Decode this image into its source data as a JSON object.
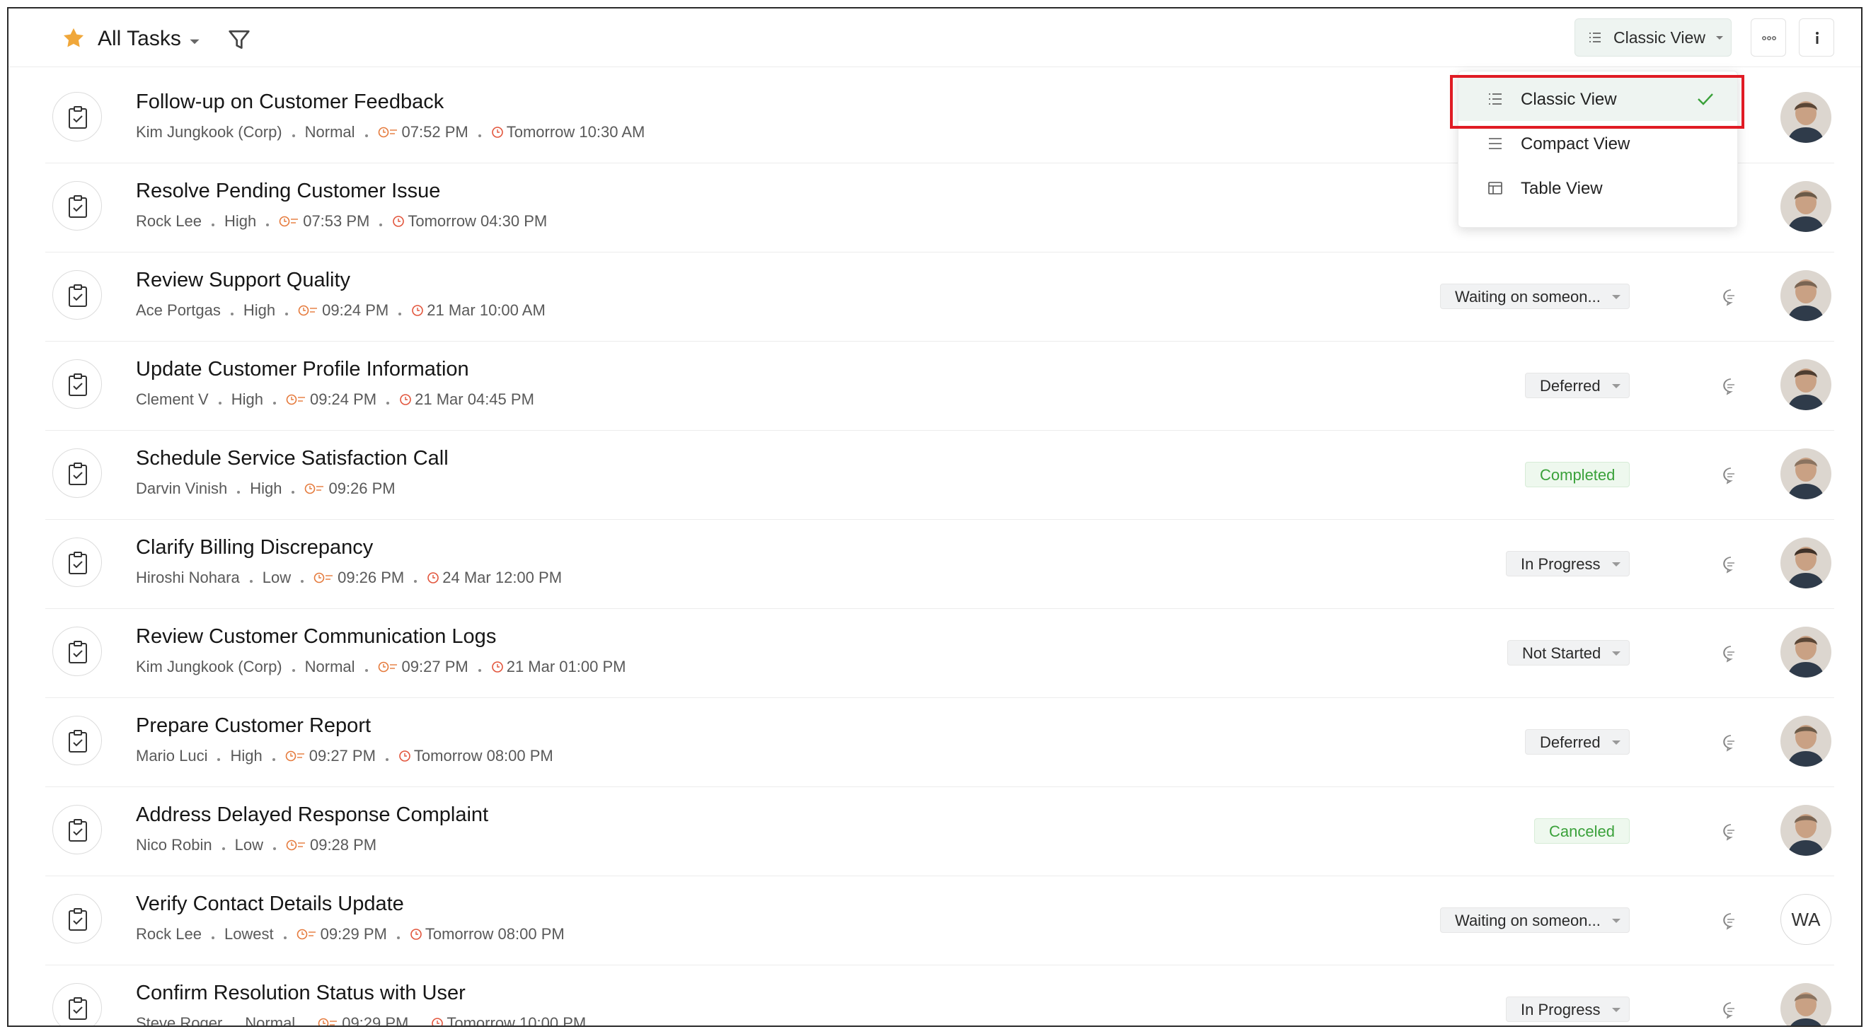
{
  "header": {
    "title": "All Tasks",
    "view_button_label": "Classic View",
    "colors": {
      "star": "#f0a73a",
      "accent_bg": "#eef4f1"
    }
  },
  "view_menu": {
    "items": [
      {
        "label": "Classic View",
        "icon": "list-icon",
        "selected": true
      },
      {
        "label": "Compact View",
        "icon": "compact-list-icon",
        "selected": false
      },
      {
        "label": "Table View",
        "icon": "table-icon",
        "selected": false
      }
    ]
  },
  "tasks": [
    {
      "title": "Follow-up on Customer Feedback",
      "owner": "Kim Jungkook (Corp)",
      "priority": "Normal",
      "created": "07:52 PM",
      "due": "Tomorrow 10:30 AM",
      "status": "",
      "avatar": "photo"
    },
    {
      "title": "Resolve Pending Customer Issue",
      "owner": "Rock Lee",
      "priority": "High",
      "created": "07:53 PM",
      "due": "Tomorrow 04:30 PM",
      "status": "",
      "avatar": "photo"
    },
    {
      "title": "Review Support Quality",
      "owner": "Ace Portgas",
      "priority": "High",
      "created": "09:24 PM",
      "due": "21 Mar 10:00 AM",
      "status": "Waiting on someon...",
      "avatar": "photo"
    },
    {
      "title": "Update Customer Profile Information",
      "owner": "Clement V",
      "priority": "High",
      "created": "09:24 PM",
      "due": "21 Mar 04:45 PM",
      "status": "Deferred",
      "avatar": "photo"
    },
    {
      "title": "Schedule Service Satisfaction Call",
      "owner": "Darvin Vinish",
      "priority": "High",
      "created": "09:26 PM",
      "due": "",
      "status": "Completed",
      "avatar": "photo"
    },
    {
      "title": "Clarify Billing Discrepancy",
      "owner": "Hiroshi Nohara",
      "priority": "Low",
      "created": "09:26 PM",
      "due": "24 Mar 12:00 PM",
      "status": "In Progress",
      "avatar": "photo"
    },
    {
      "title": "Review Customer Communication Logs",
      "owner": "Kim Jungkook (Corp)",
      "priority": "Normal",
      "created": "09:27 PM",
      "due": "21 Mar 01:00 PM",
      "status": "Not Started",
      "avatar": "photo"
    },
    {
      "title": "Prepare Customer Report",
      "owner": "Mario Luci",
      "priority": "High",
      "created": "09:27 PM",
      "due": "Tomorrow 08:00 PM",
      "status": "Deferred",
      "avatar": "photo"
    },
    {
      "title": "Address Delayed Response Complaint",
      "owner": "Nico Robin",
      "priority": "Low",
      "created": "09:28 PM",
      "due": "",
      "status": "Canceled",
      "avatar": "photo"
    },
    {
      "title": "Verify Contact Details Update",
      "owner": "Rock Lee",
      "priority": "Lowest",
      "created": "09:29 PM",
      "due": "Tomorrow 08:00 PM",
      "status": "Waiting on someon...",
      "avatar": "WA"
    },
    {
      "title": "Confirm Resolution Status with User",
      "owner": "Steve Roger",
      "priority": "Normal",
      "created": "09:29 PM",
      "due": "Tomorrow 10:00 PM",
      "status": "In Progress",
      "avatar": "photo"
    }
  ]
}
